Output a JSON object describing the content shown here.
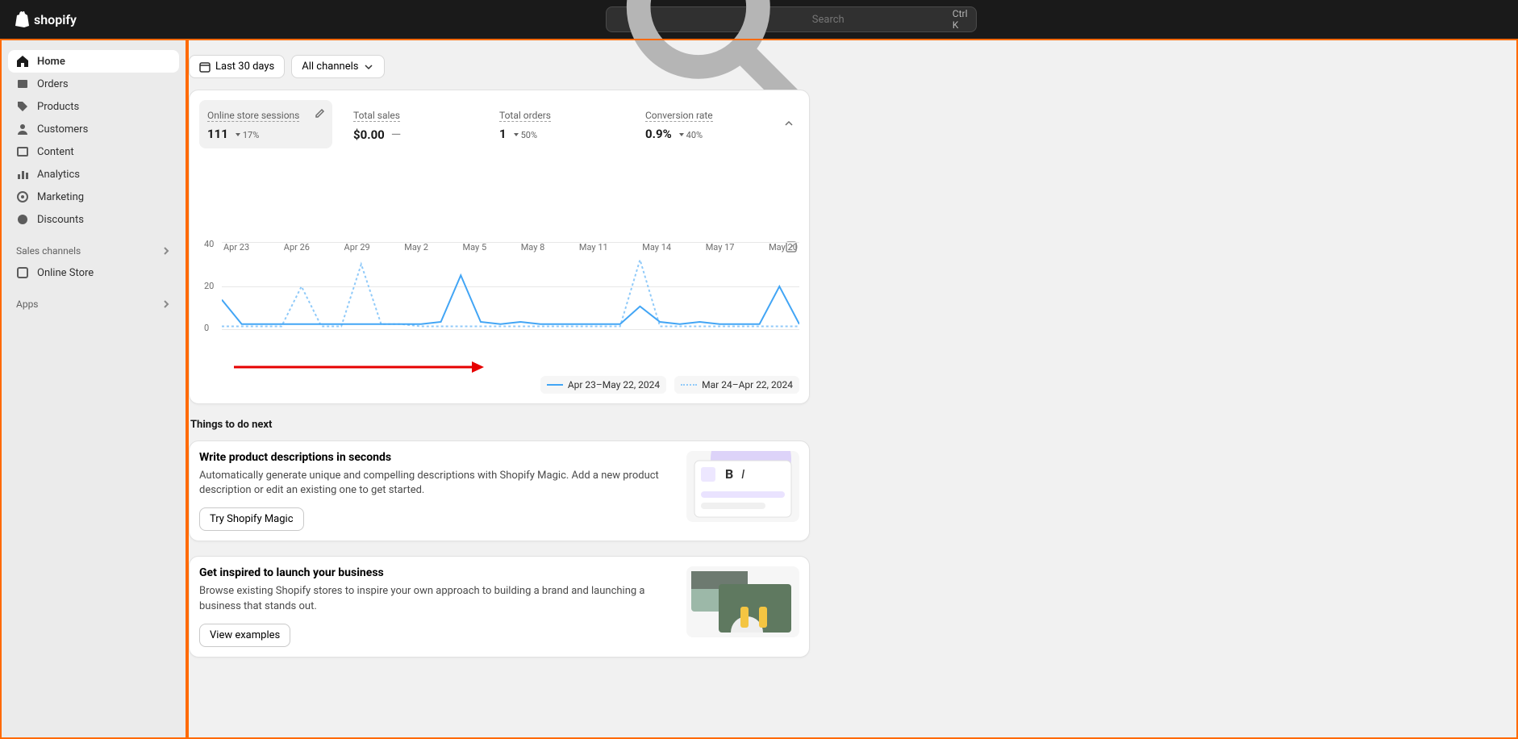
{
  "header": {
    "brand": "shopify",
    "search_placeholder": "Search",
    "search_shortcut": "Ctrl K"
  },
  "sidebar": {
    "items": [
      {
        "label": "Home",
        "icon": "home",
        "active": true
      },
      {
        "label": "Orders",
        "icon": "orders"
      },
      {
        "label": "Products",
        "icon": "products"
      },
      {
        "label": "Customers",
        "icon": "customers"
      },
      {
        "label": "Content",
        "icon": "content"
      },
      {
        "label": "Analytics",
        "icon": "analytics"
      },
      {
        "label": "Marketing",
        "icon": "marketing"
      },
      {
        "label": "Discounts",
        "icon": "discounts"
      }
    ],
    "sales_channels_label": "Sales channels",
    "channels": [
      {
        "label": "Online Store",
        "icon": "online-store"
      }
    ],
    "apps_label": "Apps"
  },
  "filters": {
    "date_range": "Last 30 days",
    "channel": "All channels"
  },
  "metrics": [
    {
      "label": "Online store sessions",
      "value": "111",
      "delta": "17%",
      "selected": true
    },
    {
      "label": "Total sales",
      "value": "$0.00",
      "delta": "—"
    },
    {
      "label": "Total orders",
      "value": "1",
      "delta": "50%"
    },
    {
      "label": "Conversion rate",
      "value": "0.9%",
      "delta": "40%"
    }
  ],
  "chart_data": {
    "type": "line",
    "ylabel": "",
    "ylim": [
      0,
      40
    ],
    "y_ticks": [
      0,
      20,
      40
    ],
    "x_ticks": [
      "Apr 23",
      "Apr 26",
      "Apr 29",
      "May 2",
      "May 5",
      "May 8",
      "May 11",
      "May 14",
      "May 17",
      "May 20"
    ],
    "series": [
      {
        "name": "Apr 23–May 22, 2024",
        "style": "solid",
        "color": "#42a5f5",
        "values": [
          14,
          3,
          3,
          3,
          3,
          3,
          3,
          3,
          3,
          3,
          3,
          4,
          25,
          4,
          3,
          4,
          3,
          3,
          3,
          3,
          3,
          11,
          4,
          3,
          4,
          3,
          3,
          3,
          20,
          3
        ]
      },
      {
        "name": "Mar 24–Apr 22, 2024",
        "style": "dotted",
        "color": "#90caf9",
        "values": [
          2,
          2,
          2,
          2,
          20,
          2,
          2,
          30,
          3,
          3,
          2,
          2,
          2,
          2,
          2,
          2,
          2,
          2,
          2,
          2,
          2,
          32,
          2,
          2,
          2,
          2,
          2,
          2,
          2,
          2
        ]
      }
    ],
    "legend": [
      {
        "label": "Apr 23–May 22, 2024",
        "style": "solid"
      },
      {
        "label": "Mar 24–Apr 22, 2024",
        "style": "dotted"
      }
    ]
  },
  "things_title": "Things to do next",
  "todos": [
    {
      "title": "Write product descriptions in seconds",
      "desc": "Automatically generate unique and compelling descriptions with Shopify Magic. Add a new product description or edit an existing one to get started.",
      "button": "Try Shopify Magic"
    },
    {
      "title": "Get inspired to launch your business",
      "desc": "Browse existing Shopify stores to inspire your own approach to building a brand and launching a business that stands out.",
      "button": "View examples"
    }
  ]
}
